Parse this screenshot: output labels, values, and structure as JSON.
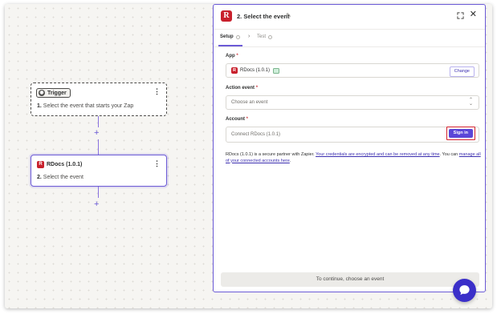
{
  "canvas": {
    "trigger_node": {
      "badge_label": "Trigger",
      "step_number": "1.",
      "step_text": "Select the event that starts your Zap",
      "menu_glyph": "⋮"
    },
    "action_node": {
      "app_badge": "R",
      "title": "RDocs (1.0.1)",
      "step_number": "2.",
      "step_text": "Select the event",
      "menu_glyph": "⋮"
    },
    "add_step_glyph": "+"
  },
  "panel": {
    "logo_glyph": "R",
    "title": "2. Select the event",
    "edit_icon": "pencil-icon",
    "close_glyph": "✕",
    "tabs": [
      {
        "label": "Setup",
        "active": true
      },
      {
        "label": "Test",
        "active": false
      }
    ],
    "tab_separator": "›",
    "app_field": {
      "label": "App",
      "required_mark": "*",
      "app_badge": "R",
      "app_name": "RDocs (1.0.1)",
      "change_label": "Change"
    },
    "action_event_field": {
      "label": "Action event",
      "required_mark": "*",
      "placeholder": "Choose an event",
      "arrows": "⌃⌄"
    },
    "account_field": {
      "label": "Account",
      "required_mark": "*",
      "placeholder": "Connect RDocs (1.0.1)",
      "signin_label": "Sign in"
    },
    "info": {
      "prefix": "RDocs (1.0.1) is a secure partner with Zapier.",
      "link1": "Your credentials are encrypted and can be removed at any time",
      "middle": ". You can",
      "link2": "manage all of your connected accounts here",
      "suffix": "."
    },
    "continue_label": "To continue, choose an event"
  },
  "colors": {
    "accent": "#6b5ad6",
    "brand_red": "#c8202c",
    "highlight_red": "#d3202c",
    "chat": "#3b2fc9"
  }
}
